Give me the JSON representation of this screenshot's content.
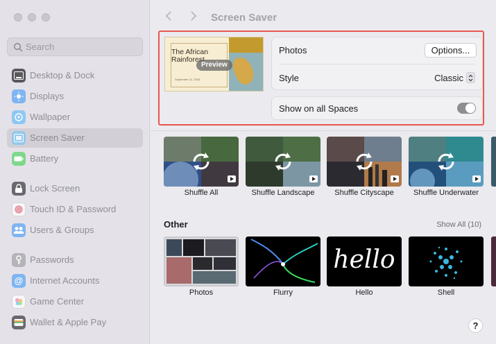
{
  "sidebar": {
    "search_placeholder": "Search",
    "items": [
      {
        "label": "Desktop & Dock",
        "icon": "desktop-dock-icon",
        "color": "#3a3a3c"
      },
      {
        "label": "Displays",
        "icon": "displays-icon",
        "color": "#3f8ff0"
      },
      {
        "label": "Wallpaper",
        "icon": "wallpaper-icon",
        "color": "#4aa8f0"
      },
      {
        "label": "Screen Saver",
        "icon": "screen-saver-icon",
        "color": "#5ab2e6"
      },
      {
        "label": "Battery",
        "icon": "battery-icon",
        "color": "#46c45a"
      },
      {
        "label": "Lock Screen",
        "icon": "lock-icon",
        "color": "#3a3a3c"
      },
      {
        "label": "Touch ID & Password",
        "icon": "fingerprint-icon",
        "color": "#ffffff"
      },
      {
        "label": "Users & Groups",
        "icon": "users-icon",
        "color": "#3f8ff0"
      },
      {
        "label": "Passwords",
        "icon": "key-icon",
        "color": "#8e8e93"
      },
      {
        "label": "Internet Accounts",
        "icon": "at-icon",
        "color": "#3f8ff0"
      },
      {
        "label": "Game Center",
        "icon": "game-center-icon",
        "color": "#ffffff"
      },
      {
        "label": "Wallet & Apple Pay",
        "icon": "wallet-icon",
        "color": "#3a3a3c"
      }
    ]
  },
  "header": {
    "title": "Screen Saver"
  },
  "preview": {
    "title": "The African Rainforest",
    "date": "September 21, 2023",
    "badge": "Preview"
  },
  "settings": {
    "photos_label": "Photos",
    "options_button": "Options...",
    "style_label": "Style",
    "style_value": "Classic",
    "spaces_label": "Show on all Spaces",
    "spaces_on": true
  },
  "shuffle": [
    {
      "label": "Shuffle All"
    },
    {
      "label": "Shuffle Landscape"
    },
    {
      "label": "Shuffle Cityscape"
    },
    {
      "label": "Shuffle Underwater"
    }
  ],
  "other": {
    "title": "Other",
    "show_all": "Show All (10)",
    "items": [
      {
        "label": "Photos"
      },
      {
        "label": "Flurry"
      },
      {
        "label": "Hello",
        "art_text": "hello"
      },
      {
        "label": "Shell"
      }
    ]
  },
  "help_label": "?",
  "colors": {
    "highlight_border": "#e8574f",
    "sidebar_bg": "#e4e2e8",
    "main_bg": "#ebeaee"
  }
}
